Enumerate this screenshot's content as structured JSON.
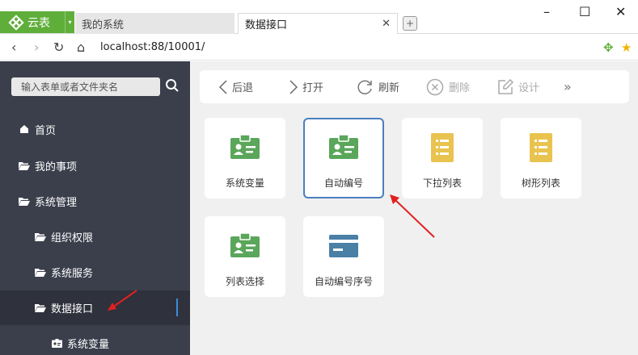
{
  "browser": {
    "brand_name": "云表",
    "tabs": [
      {
        "label": "我的系统"
      },
      {
        "label": "数据接口"
      }
    ],
    "url": "localhost:88/10001/"
  },
  "sidebar": {
    "search_placeholder": "输入表单或者文件夹名",
    "items": [
      {
        "label": "首页",
        "icon": "home-icon"
      },
      {
        "label": "我的事项",
        "icon": "folder-open-icon"
      },
      {
        "label": "系统管理",
        "icon": "folder-open-icon"
      },
      {
        "label": "组织权限",
        "icon": "folder-open-icon"
      },
      {
        "label": "系统服务",
        "icon": "folder-open-icon"
      },
      {
        "label": "数据接口",
        "icon": "folder-open-icon"
      },
      {
        "label": "系统变量",
        "icon": "id-card-icon"
      }
    ]
  },
  "toolbar": {
    "back": "后退",
    "open": "打开",
    "refresh": "刷新",
    "delete": "删除",
    "design": "设计"
  },
  "tiles": [
    {
      "label": "系统变量",
      "icon": "id-card-icon"
    },
    {
      "label": "自动编号",
      "icon": "id-card-icon"
    },
    {
      "label": "下拉列表",
      "icon": "list-doc-icon"
    },
    {
      "label": "树形列表",
      "icon": "list-doc-icon"
    },
    {
      "label": "列表选择",
      "icon": "id-card-icon"
    },
    {
      "label": "自动编号序号",
      "icon": "card-icon"
    }
  ],
  "colors": {
    "accent_green": "#5fae3a",
    "sidebar_bg": "#3b3f4c",
    "tile_green": "#5aa65a",
    "tile_yellow": "#e9c34f",
    "tile_blue": "#4a7fa6",
    "annotation_red": "#e02020"
  }
}
